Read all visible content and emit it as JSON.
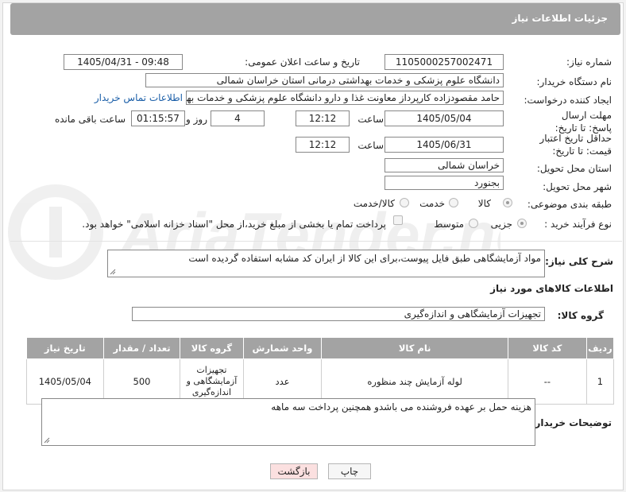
{
  "header": {
    "title": "جزئیات اطلاعات نیاز"
  },
  "form": {
    "need_number_label": "شماره نیاز:",
    "need_number": "1105000257002471",
    "announce_label": "تاریخ و ساعت اعلان عمومی:",
    "announce_value": "1405/04/31 - 09:48",
    "buyer_org_label": "نام دستگاه خریدار:",
    "buyer_org": "دانشگاه علوم پزشکی و خدمات بهداشتی درمانی استان خراسان شمالی",
    "requester_label": "ایجاد کننده درخواست:",
    "requester": "حامد مقصودزاده کارپرداز معاونت غذا و دارو دانشگاه علوم پزشکی و خدمات بهداشتی",
    "contact_link": "اطلاعات تماس خریدار",
    "deadline_label": "مهلت ارسال پاسخ: تا تاریخ:",
    "deadline_date": "1405/05/04",
    "time_label": "ساعت",
    "deadline_time": "12:12",
    "days_value": "4",
    "days_label": "روز و",
    "remaining_value": "01:15:57",
    "remaining_label": "ساعت باقی مانده",
    "validity_label": "حداقل تاریخ اعتبار قیمت: تا تاریخ:",
    "validity_date": "1405/06/31",
    "validity_time": "12:12",
    "province_label": "استان محل تحویل:",
    "province": "خراسان شمالی",
    "city_label": "شهر محل تحویل:",
    "city": "بجنورد",
    "category_label": "طبقه بندی موضوعی:",
    "category_options": [
      "کالا",
      "خدمت",
      "کالا/خدمت"
    ],
    "category_selected": "کالا",
    "process_label": "نوع فرآیند خرید :",
    "process_options": [
      "جزیی",
      "متوسط"
    ],
    "process_selected": "جزیی",
    "payment_note": "پرداخت تمام یا بخشی از مبلغ خرید،از محل \"اسناد خزانه اسلامی\" خواهد بود."
  },
  "description": {
    "label": "شرح کلی نیاز:",
    "text": "مواد آزمایشگاهی طبق فایل پیوست،برای این کالا از ایران کد مشابه استفاده گردیده است"
  },
  "goods_section": {
    "title": "اطلاعات کالاهای مورد نیاز",
    "group_label": "گروه کالا:",
    "group_value": "تجهیزات آزمایشگاهی و اندازه‌گیری"
  },
  "table": {
    "headers": [
      "ردیف",
      "کد کالا",
      "نام کالا",
      "واحد شمارش",
      "گروه کالا",
      "تعداد / مقدار",
      "تاریخ نیاز"
    ],
    "rows": [
      [
        "1",
        "--",
        "لوله آزمایش چند منظوره",
        "عدد",
        "تجهیزات آزمایشگاهی و اندازه‌گیری",
        "500",
        "1405/05/04"
      ]
    ]
  },
  "buyer_notes": {
    "label": "توضیحات خریدار:",
    "text": "هزینه حمل بر عهده فروشنده می باشدو همچنین پرداخت سه ماهه"
  },
  "buttons": {
    "print": "چاپ",
    "back": "بازگشت"
  },
  "watermark_text": "AriaTender.net",
  "colors": {
    "header_bg": "#a3a3a3",
    "link": "#1a5ea8",
    "back_btn": "#fbe0e0",
    "print_btn": "#f6f6f6"
  }
}
